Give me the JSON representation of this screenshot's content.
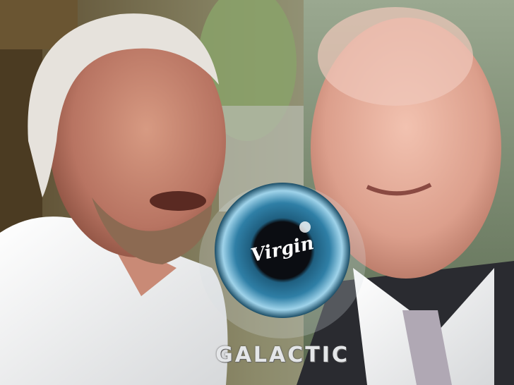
{
  "photo": {
    "left_person": "older-man-white-hair-beard",
    "right_person": "bald-man-suit-tie",
    "background": "city-street-trees-buildings"
  },
  "logo": {
    "brand_word": "Virgin",
    "product_word": "GALACTIC",
    "emblem": "blue-eye-iris-icon",
    "colors": {
      "iris": "#2f7fa6",
      "iris_light": "#9fd3ea",
      "pupil": "#0b0d12",
      "text": "#e4e6e8"
    }
  }
}
